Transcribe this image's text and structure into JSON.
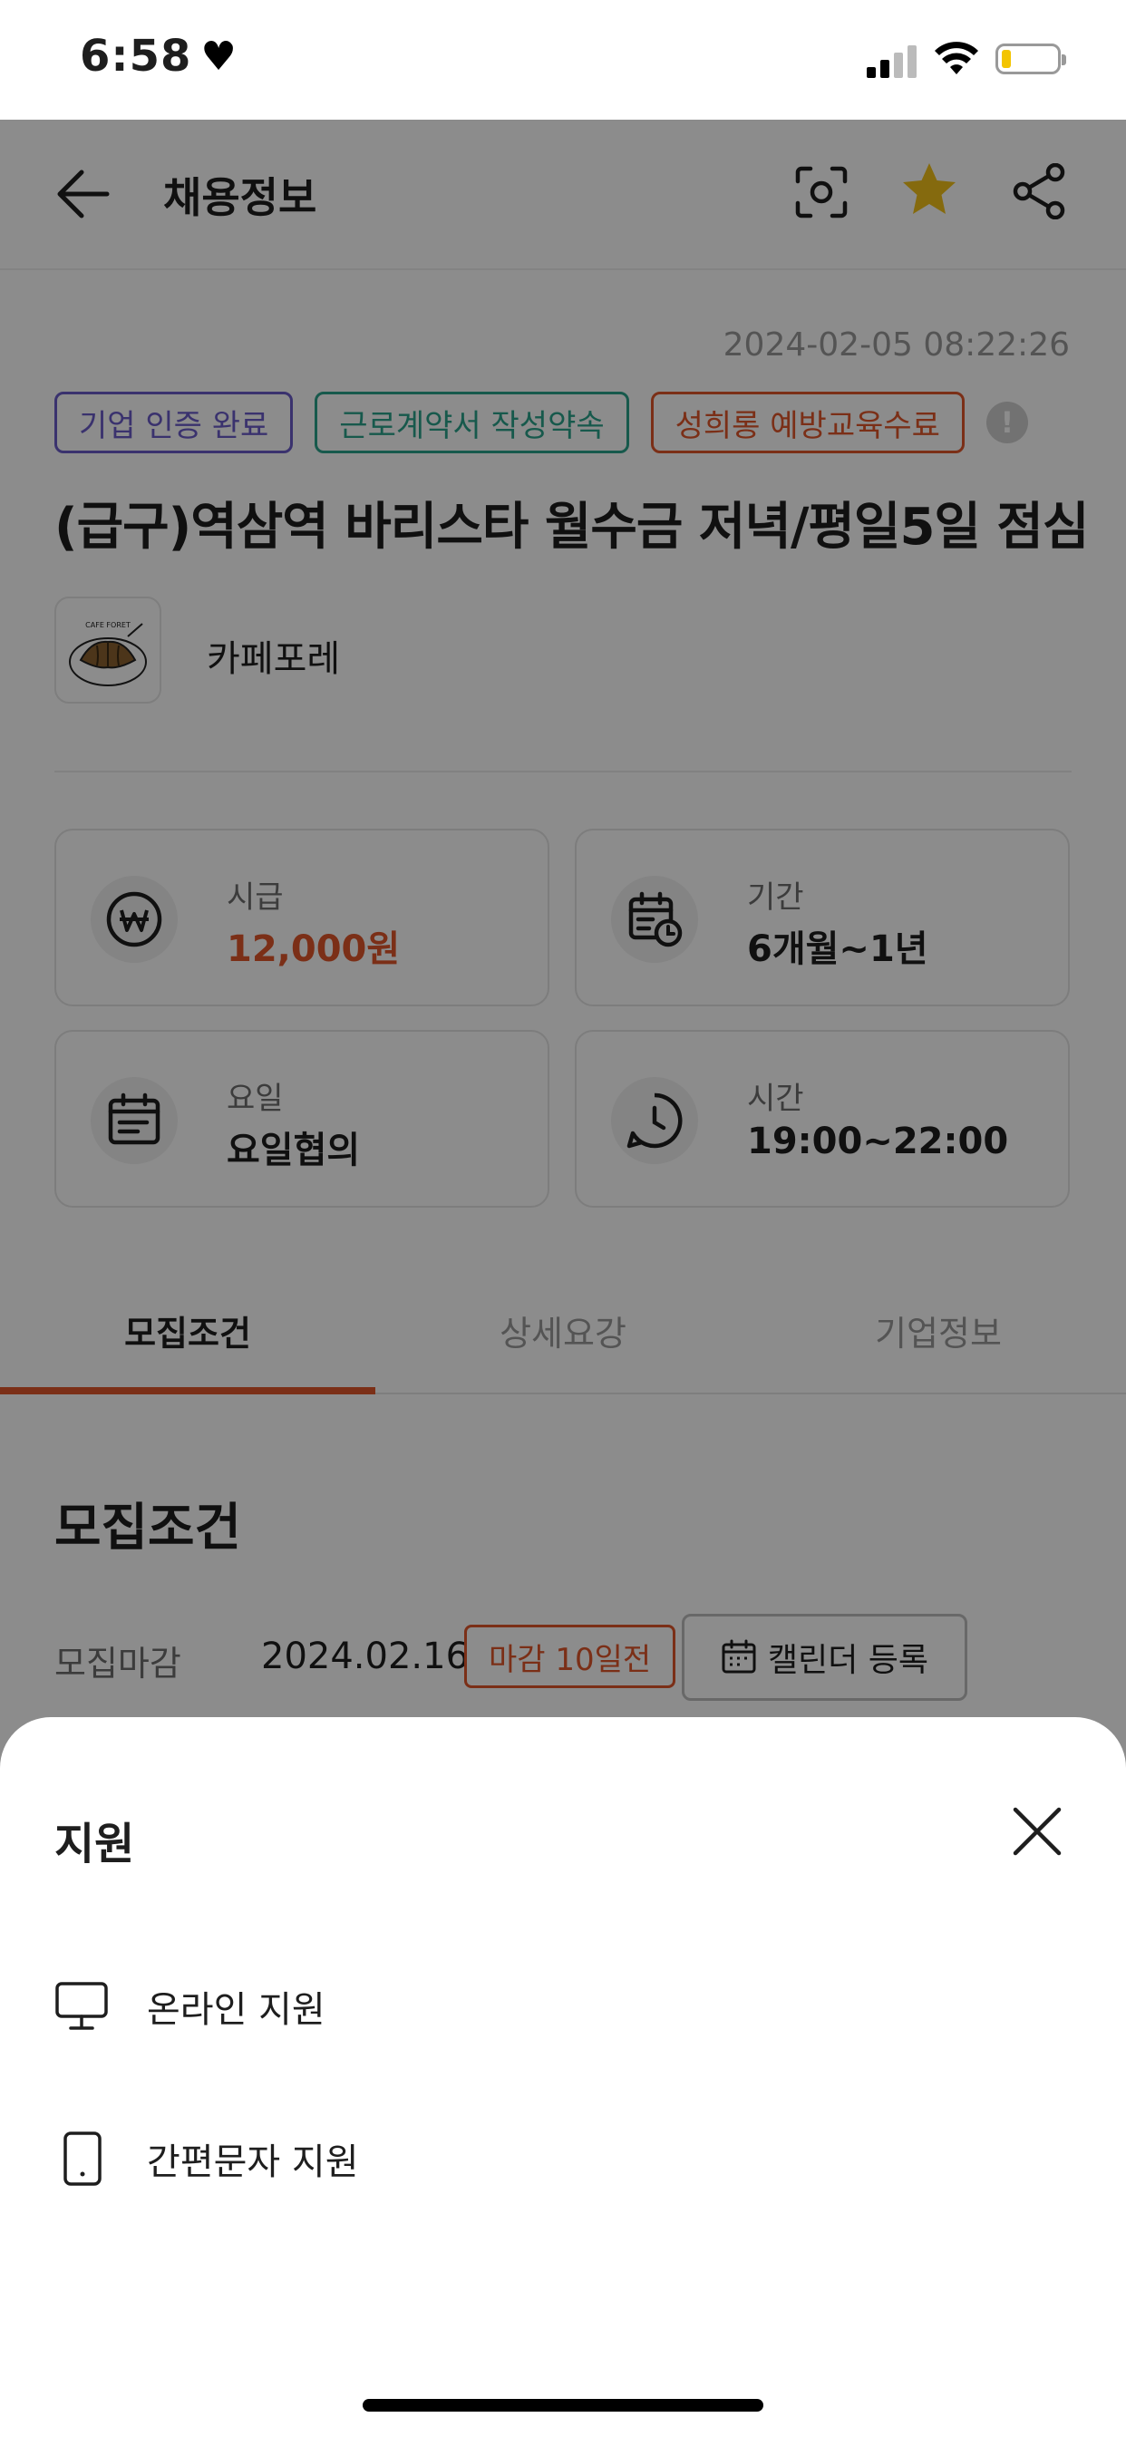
{
  "status_bar": {
    "time": "6:58",
    "battery_level": 0.15
  },
  "header": {
    "title": "채용정보",
    "starred": true
  },
  "job": {
    "posted_at": "2024-02-05 08:22:26",
    "badges": [
      {
        "label": "기업 인증 완료",
        "color": "#6b5cc8"
      },
      {
        "label": "근로계약서 작성약속",
        "color": "#2aa38a"
      },
      {
        "label": "성희롱 예방교육수료",
        "color": "#e0572a"
      }
    ],
    "title": "(급구)역삼역 바리스타 월수금 저녁/평일5일 점심",
    "company": "카페포레",
    "logo_text": "CAFE FORET"
  },
  "info_cards": {
    "wage": {
      "label": "시급",
      "value": "12,000원",
      "icon": "won-icon"
    },
    "period": {
      "label": "기간",
      "value": "6개월~1년",
      "icon": "calendar-clock-icon"
    },
    "days": {
      "label": "요일",
      "value": "요일협의",
      "icon": "calendar-icon"
    },
    "hours": {
      "label": "시간",
      "value": "19:00~22:00",
      "icon": "clock-icon"
    }
  },
  "tabs": [
    "모집조건",
    "상세요강",
    "기업정보"
  ],
  "active_tab": "모집조건",
  "section": {
    "title": "모집조건",
    "deadline_label": "모집마감",
    "deadline_date": "2024.02.16",
    "dday": "마감 10일전",
    "calendar_button": "캘린더 등록"
  },
  "sheet": {
    "title": "지원",
    "options": [
      {
        "label": "온라인 지원",
        "icon": "monitor-icon"
      },
      {
        "label": "간편문자 지원",
        "icon": "phone-icon"
      }
    ]
  },
  "colors": {
    "accent": "#e0572a",
    "star": "#f2c21b"
  }
}
